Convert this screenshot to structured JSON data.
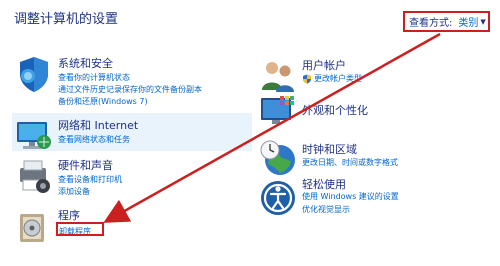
{
  "page": {
    "title": "调整计算机的设置",
    "view_by": {
      "label": "查看方式:",
      "value": "类别"
    }
  },
  "categories": [
    {
      "title": "系统和安全",
      "links": [
        "查看你的计算机状态",
        "通过文件历史记录保存你的文件备份副本",
        "备份和还原(Windows 7)"
      ]
    },
    {
      "title": "网络和 Internet",
      "links": [
        "查看网络状态和任务"
      ]
    },
    {
      "title": "硬件和声音",
      "links": [
        "查看设备和打印机",
        "添加设备"
      ]
    },
    {
      "title": "程序",
      "links": [
        "卸载程序"
      ]
    },
    {
      "title": "用户帐户",
      "links": [
        "更改帐户类型"
      ]
    },
    {
      "title": "外观和个性化",
      "links": []
    },
    {
      "title": "时钟和区域",
      "links": [
        "更改日期、时间或数字格式"
      ]
    },
    {
      "title": "轻松使用",
      "links": [
        "使用 Windows 建议的设置",
        "优化视觉显示"
      ]
    }
  ],
  "icons": {
    "security": "shield-icon",
    "network": "network-icon",
    "hardware": "printer-icon",
    "programs": "programs-icon",
    "users": "user-accounts-icon",
    "appearance": "appearance-icon",
    "clock": "clock-region-icon",
    "ease": "ease-of-access-icon",
    "uac": "uac-shield-icon"
  },
  "colors": {
    "annotation": "#cc1f1f",
    "link": "#0066cc",
    "heading": "#1e3287",
    "hover_row": "#e9f3fb"
  }
}
